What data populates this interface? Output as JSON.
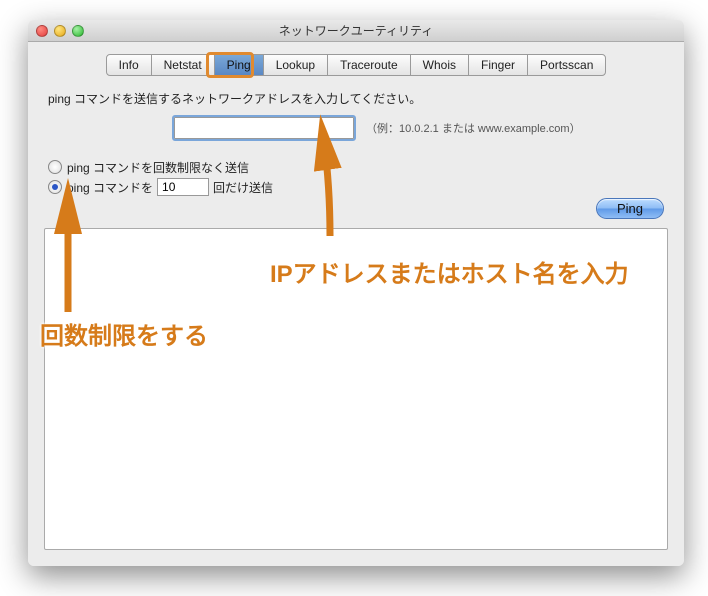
{
  "window": {
    "title": "ネットワークユーティリティ"
  },
  "tabs": [
    {
      "label": "Info"
    },
    {
      "label": "Netstat"
    },
    {
      "label": "Ping"
    },
    {
      "label": "Lookup"
    },
    {
      "label": "Traceroute"
    },
    {
      "label": "Whois"
    },
    {
      "label": "Finger"
    },
    {
      "label": "Portsscan"
    }
  ],
  "instruction": "ping コマンドを送信するネットワークアドレスを入力してください。",
  "addressField": {
    "value": ""
  },
  "addressHint": "（例：10.0.2.1 または www.example.com）",
  "radioUnlimited": "ping コマンドを回数制限なく送信",
  "radioLimitedPrefix": "ping コマンドを",
  "radioLimitedSuffix": "回だけ送信",
  "countValue": "10",
  "pingButton": "Ping",
  "annotations": {
    "addressNote": "IPアドレスまたはホスト名を入力",
    "limitNote": "回数制限をする"
  }
}
